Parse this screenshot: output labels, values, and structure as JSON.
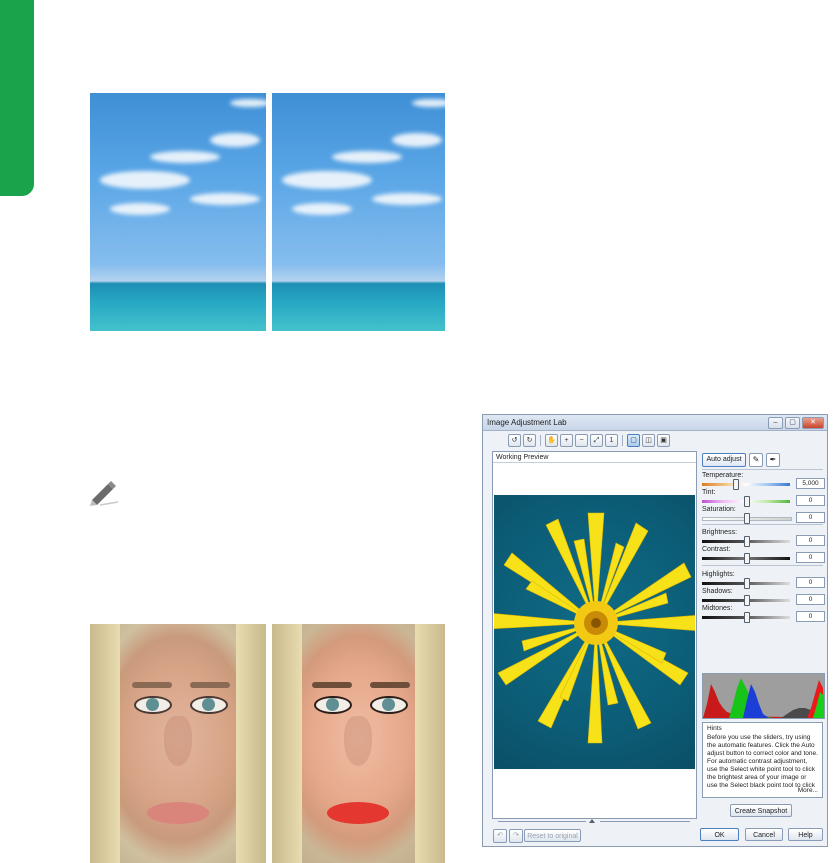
{
  "dialog": {
    "title": "Image Adjustment Lab",
    "window_buttons": [
      "–",
      "▢",
      "✕"
    ],
    "preview_label": "Working Preview",
    "auto_adjust_label": "Auto adjust",
    "reset_label": "Reset to original",
    "buttons": {
      "ok": "OK",
      "cancel": "Cancel",
      "help": "Help"
    },
    "create_snapshot_label": "Create Snapshot",
    "more_label": "More...",
    "sliders": [
      {
        "label": "Temperature:",
        "value": "5,000",
        "position": 0.38,
        "gradient": "linear-gradient(to right,#e07b22,#f0c080,#ffffff,#9fc5ef,#3a78d0)"
      },
      {
        "label": "Tint:",
        "value": "0",
        "position": 0.5,
        "gradient": "linear-gradient(to right,#c04fd0,#f0c0f4,#ffffff,#bfe8a8,#4fb83a)"
      },
      {
        "label": "Saturation:",
        "value": "0",
        "position": 0.5,
        "gradient": "linear-gradient(to right,#ffffff,#d0d0d0)"
      },
      {
        "label": "Brightness:",
        "value": "0",
        "position": 0.5,
        "gradient": "linear-gradient(to right,#111,#555,#ddd)"
      },
      {
        "label": "Contrast:",
        "value": "0",
        "position": 0.5,
        "gradient": "linear-gradient(to right,#111,#777,#111)"
      },
      {
        "label": "Highlights:",
        "value": "0",
        "position": 0.5,
        "gradient": "linear-gradient(to right,#111,#555,#ddd)"
      },
      {
        "label": "Shadows:",
        "value": "0",
        "position": 0.5,
        "gradient": "linear-gradient(to right,#111,#555,#ddd)"
      },
      {
        "label": "Midtones:",
        "value": "0",
        "position": 0.5,
        "gradient": "linear-gradient(to right,#111,#555,#ddd)"
      }
    ],
    "hints": {
      "title": "Hints",
      "text": "Before you use the sliders, try using the automatic features. Click the Auto adjust button to correct color and tone. For automatic contrast adjustment, use the Select white point tool to click the brightest area of your image or use the Select black point tool to click the darkest"
    }
  },
  "colors": {
    "brand_green": "#1aa34a",
    "dialog_bg": "#eef2f7",
    "accent_blue": "#4c7fbf"
  }
}
